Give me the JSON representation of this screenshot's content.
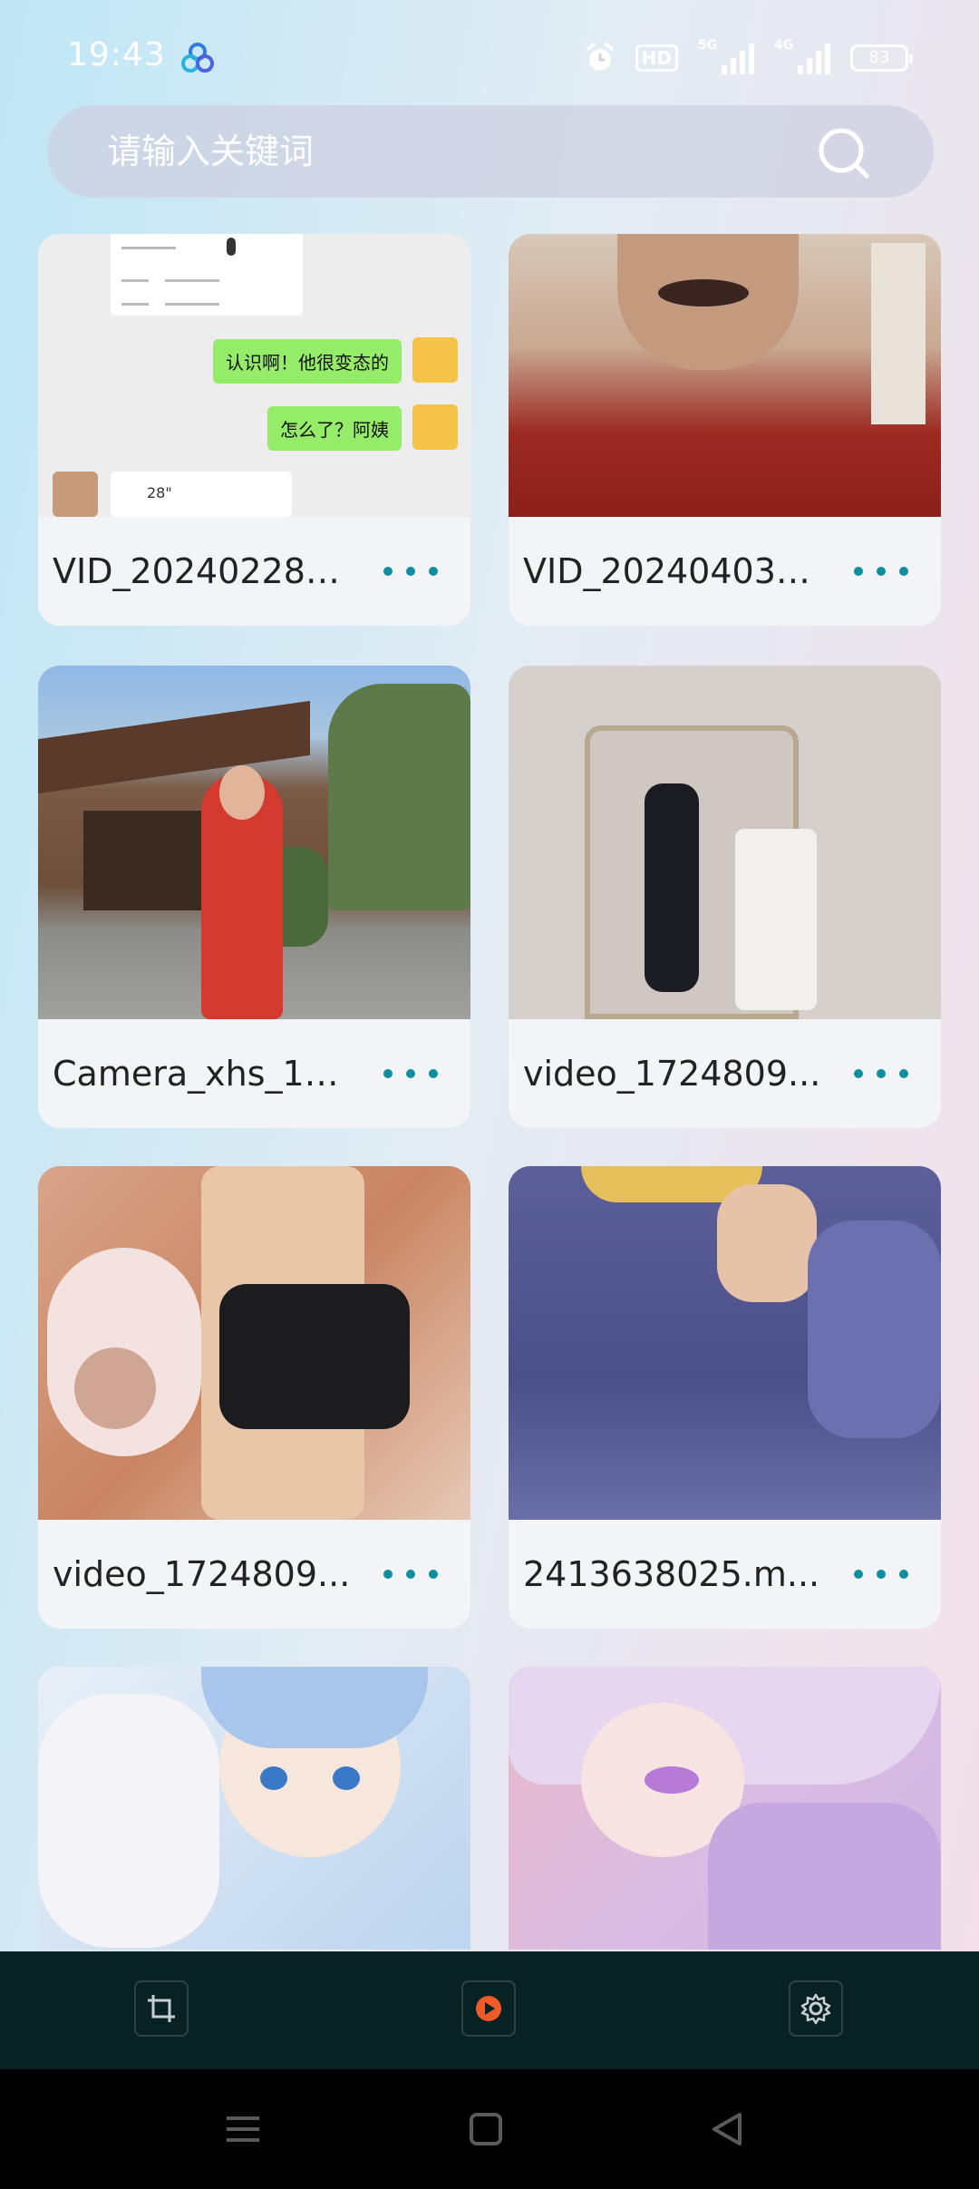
{
  "status_bar": {
    "time": "19:43",
    "hd": "HD",
    "net1": "5G",
    "net2": "4G",
    "battery": "83"
  },
  "search": {
    "placeholder": "请输入关键词"
  },
  "videos": [
    {
      "title": "VID_20240228_..."
    },
    {
      "title": "VID_20240403_..."
    },
    {
      "title": "Camera_xhs_17..."
    },
    {
      "title": "video_1724809..."
    },
    {
      "title": "video_1724809..."
    },
    {
      "title": "2413638025.m..."
    },
    {
      "title": ""
    },
    {
      "title": ""
    }
  ],
  "chat_preview": {
    "msg1": "认识啊！他很变态的",
    "msg2": "怎么了？阿姨",
    "voice": "28\""
  },
  "bottom_tabs": [
    {
      "icon": "crop-icon"
    },
    {
      "icon": "play-icon"
    },
    {
      "icon": "settings-icon"
    }
  ],
  "nav": [
    {
      "icon": "menu-icon"
    },
    {
      "icon": "home-icon"
    },
    {
      "icon": "back-icon"
    }
  ],
  "colors": {
    "accent": "#0f8ea0",
    "bottom_bar": "#082224",
    "play_accent": "#f05a28"
  }
}
